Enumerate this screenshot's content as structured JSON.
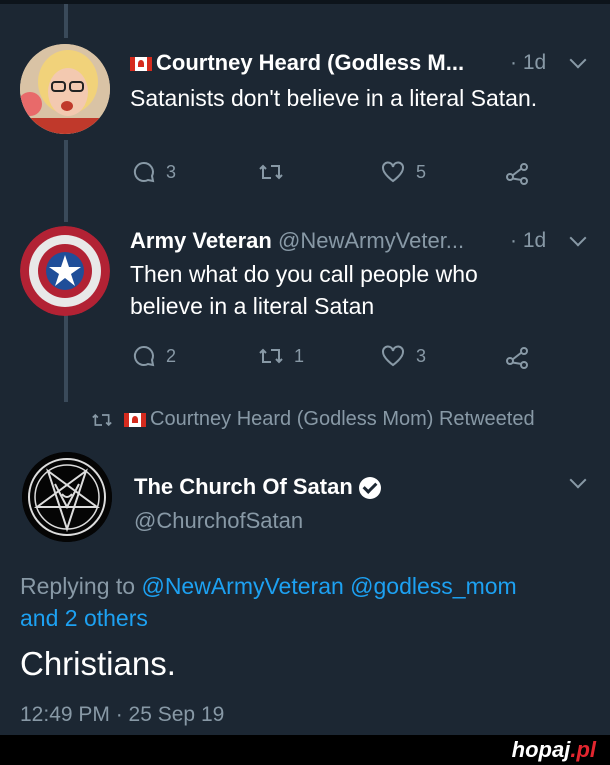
{
  "tweet1": {
    "name": "Courtney Heard (Godless M...",
    "time": "· 1d",
    "text": "Satanists don't believe in a literal Satan.",
    "replies": "3",
    "likes": "5"
  },
  "tweet2": {
    "name": "Army Veteran",
    "handle": "@NewArmyVeter...",
    "time": "· 1d",
    "text_line1": "Then what do you call people who",
    "text_line2": "believe in a literal Satan",
    "replies": "2",
    "retweets": "1",
    "likes": "3"
  },
  "retweet_notice": "Courtney Heard (Godless Mom) Retweeted",
  "main_tweet": {
    "name": "The Church Of Satan",
    "handle": "@ChurchofSatan",
    "replying_prefix": "Replying to",
    "mention1": "@NewArmyVeteran",
    "mention2": "@godless_mom",
    "others": "and 2 others",
    "text": "Christians.",
    "timestamp": "12:49 PM · 25 Sep 19"
  },
  "footer": {
    "brand": "hopaj",
    "tld": ".pl"
  }
}
